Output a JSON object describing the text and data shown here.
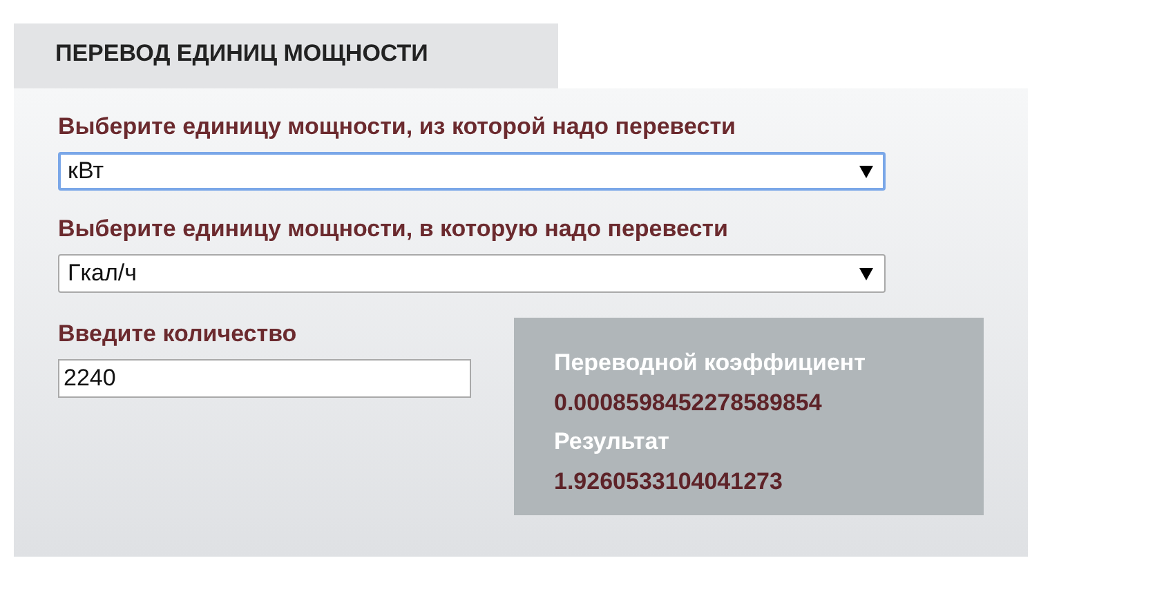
{
  "tab": {
    "title": "ПЕРЕВОД ЕДИНИЦ МОЩНОСТИ"
  },
  "selects": [
    {
      "label": "Выберите единицу мощности, из которой надо перевести",
      "value": "кВт",
      "focused": true
    },
    {
      "label": "Выберите единицу мощности, в которую надо перевести",
      "value": "Гкал/ч",
      "focused": false
    }
  ],
  "amount": {
    "label": "Введите количество",
    "value": "2240"
  },
  "result": {
    "factor_label": "Переводной коэффициент",
    "factor": "0.0008598452278589854",
    "result_label": "Результат",
    "result": "1.9260533104041273"
  }
}
